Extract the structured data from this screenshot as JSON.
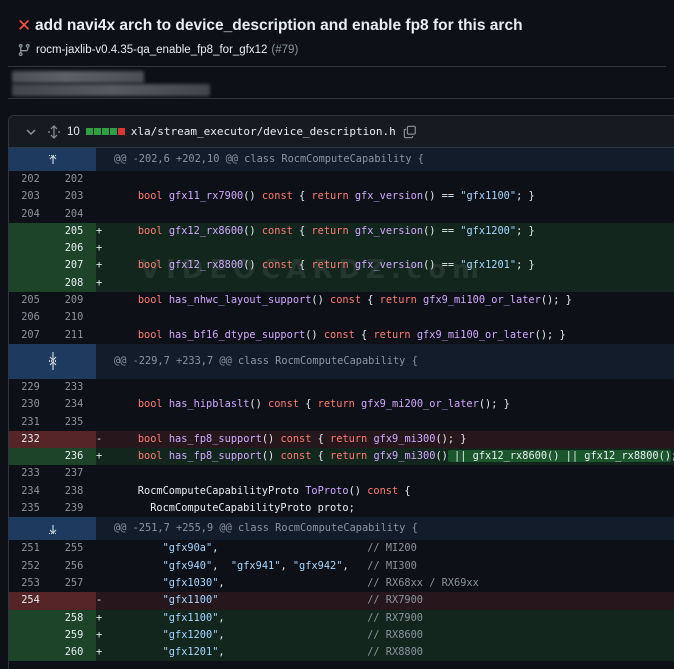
{
  "header": {
    "title": "add navi4x arch to device_description and enable fp8 for this arch",
    "branch": "rocm-jaxlib-v0.4.35-qa_enable_fp8_for_gfx12",
    "pr_number": "(#79)"
  },
  "file": {
    "changes": "10",
    "path": "xla/stream_executor/device_description.h",
    "diffstat": [
      "#2ea043",
      "#2ea043",
      "#2ea043",
      "#2ea043",
      "#da3633"
    ]
  },
  "rows": [
    {
      "type": "hunk",
      "text": "@@ -202,6 +202,10 @@ class RocmComputeCapability {",
      "icons": [
        "up"
      ]
    },
    {
      "type": "ctx",
      "o": "202",
      "n": "202",
      "segs": []
    },
    {
      "type": "ctx",
      "o": "203",
      "n": "203",
      "segs": [
        [
          "",
          "    "
        ],
        [
          "kw",
          "bool"
        ],
        [
          "",
          " "
        ],
        [
          "fn",
          "gfx11_rx7900"
        ],
        [
          "",
          "() "
        ],
        [
          "kw",
          "const"
        ],
        [
          "",
          " { "
        ],
        [
          "kw",
          "return"
        ],
        [
          "",
          " "
        ],
        [
          "fn",
          "gfx_version"
        ],
        [
          "",
          "() == "
        ],
        [
          "st",
          "\"gfx1100\""
        ],
        [
          "",
          "; }"
        ]
      ]
    },
    {
      "type": "ctx",
      "o": "204",
      "n": "204",
      "segs": []
    },
    {
      "type": "add",
      "o": "",
      "n": "205",
      "segs": [
        [
          "",
          "    "
        ],
        [
          "kw",
          "bool"
        ],
        [
          "",
          " "
        ],
        [
          "fn",
          "gfx12_rx8600"
        ],
        [
          "",
          "() "
        ],
        [
          "kw",
          "const"
        ],
        [
          "",
          " { "
        ],
        [
          "kw",
          "return"
        ],
        [
          "",
          " "
        ],
        [
          "fn",
          "gfx_version"
        ],
        [
          "",
          "() == "
        ],
        [
          "st",
          "\"gfx1200\""
        ],
        [
          "",
          "; }"
        ]
      ]
    },
    {
      "type": "add",
      "o": "",
      "n": "206",
      "segs": []
    },
    {
      "type": "add",
      "o": "",
      "n": "207",
      "segs": [
        [
          "",
          "    "
        ],
        [
          "kw",
          "bool"
        ],
        [
          "",
          " "
        ],
        [
          "fn",
          "gfx12_rx8800"
        ],
        [
          "",
          "() "
        ],
        [
          "kw",
          "const"
        ],
        [
          "",
          " { "
        ],
        [
          "kw",
          "return"
        ],
        [
          "",
          " "
        ],
        [
          "fn",
          "gfx_version"
        ],
        [
          "",
          "() == "
        ],
        [
          "st",
          "\"gfx1201\""
        ],
        [
          "",
          "; }"
        ]
      ]
    },
    {
      "type": "add",
      "o": "",
      "n": "208",
      "segs": []
    },
    {
      "type": "ctx",
      "o": "205",
      "n": "209",
      "segs": [
        [
          "",
          "    "
        ],
        [
          "kw",
          "bool"
        ],
        [
          "",
          " "
        ],
        [
          "fn",
          "has_nhwc_layout_support"
        ],
        [
          "",
          "() "
        ],
        [
          "kw",
          "const"
        ],
        [
          "",
          " { "
        ],
        [
          "kw",
          "return"
        ],
        [
          "",
          " "
        ],
        [
          "fn",
          "gfx9_mi100_or_later"
        ],
        [
          "",
          "(); }"
        ]
      ]
    },
    {
      "type": "ctx",
      "o": "206",
      "n": "210",
      "segs": []
    },
    {
      "type": "ctx",
      "o": "207",
      "n": "211",
      "segs": [
        [
          "",
          "    "
        ],
        [
          "kw",
          "bool"
        ],
        [
          "",
          " "
        ],
        [
          "fn",
          "has_bf16_dtype_support"
        ],
        [
          "",
          "() "
        ],
        [
          "kw",
          "const"
        ],
        [
          "",
          " { "
        ],
        [
          "kw",
          "return"
        ],
        [
          "",
          " "
        ],
        [
          "fn",
          "gfx9_mi100_or_later"
        ],
        [
          "",
          "(); }"
        ]
      ]
    },
    {
      "type": "hunk",
      "text": "@@ -229,7 +233,7 @@ class RocmComputeCapability {",
      "icons": [
        "down",
        "up"
      ]
    },
    {
      "type": "ctx",
      "o": "229",
      "n": "233",
      "segs": []
    },
    {
      "type": "ctx",
      "o": "230",
      "n": "234",
      "segs": [
        [
          "",
          "    "
        ],
        [
          "kw",
          "bool"
        ],
        [
          "",
          " "
        ],
        [
          "fn",
          "has_hipblaslt"
        ],
        [
          "",
          "() "
        ],
        [
          "kw",
          "const"
        ],
        [
          "",
          " { "
        ],
        [
          "kw",
          "return"
        ],
        [
          "",
          " "
        ],
        [
          "fn",
          "gfx9_mi200_or_later"
        ],
        [
          "",
          "(); }"
        ]
      ]
    },
    {
      "type": "ctx",
      "o": "231",
      "n": "235",
      "segs": []
    },
    {
      "type": "del",
      "o": "232",
      "n": "",
      "segs": [
        [
          "",
          "    "
        ],
        [
          "kw",
          "bool"
        ],
        [
          "",
          " "
        ],
        [
          "fn",
          "has_fp8_support"
        ],
        [
          "",
          "() "
        ],
        [
          "kw",
          "const"
        ],
        [
          "",
          " { "
        ],
        [
          "kw",
          "return"
        ],
        [
          "",
          " "
        ],
        [
          "fn",
          "gfx9_mi300"
        ],
        [
          "",
          "(); }"
        ]
      ]
    },
    {
      "type": "add",
      "o": "",
      "n": "236",
      "segs": [
        [
          "",
          "    "
        ],
        [
          "kw",
          "bool"
        ],
        [
          "",
          " "
        ],
        [
          "fn",
          "has_fp8_support"
        ],
        [
          "",
          "() "
        ],
        [
          "kw",
          "const"
        ],
        [
          "",
          " { "
        ],
        [
          "kw",
          "return"
        ],
        [
          "",
          " "
        ],
        [
          "fn",
          "gfx9_mi300"
        ],
        [
          "",
          "()"
        ],
        [
          "hl",
          " || gfx12_rx8600() || gfx12_rx8800()"
        ],
        [
          "",
          "; }"
        ]
      ]
    },
    {
      "type": "ctx",
      "o": "233",
      "n": "237",
      "segs": []
    },
    {
      "type": "ctx",
      "o": "234",
      "n": "238",
      "segs": [
        [
          "",
          "    RocmComputeCapabilityProto "
        ],
        [
          "fn",
          "ToProto"
        ],
        [
          "",
          "() "
        ],
        [
          "kw",
          "const"
        ],
        [
          "",
          " {"
        ]
      ]
    },
    {
      "type": "ctx",
      "o": "235",
      "n": "239",
      "segs": [
        [
          "",
          "      RocmComputeCapabilityProto proto;"
        ]
      ]
    },
    {
      "type": "hunk",
      "text": "@@ -251,7 +255,9 @@ class RocmComputeCapability {",
      "icons": [
        "down"
      ]
    },
    {
      "type": "ctx",
      "o": "251",
      "n": "255",
      "segs": [
        [
          "",
          "        "
        ],
        [
          "st",
          "\"gfx90a\""
        ],
        [
          "",
          ",                        "
        ],
        [
          "cm",
          "// MI200"
        ]
      ]
    },
    {
      "type": "ctx",
      "o": "252",
      "n": "256",
      "segs": [
        [
          "",
          "        "
        ],
        [
          "st",
          "\"gfx940\""
        ],
        [
          "",
          ",  "
        ],
        [
          "st",
          "\"gfx941\""
        ],
        [
          "",
          ", "
        ],
        [
          "st",
          "\"gfx942\""
        ],
        [
          "",
          ",   "
        ],
        [
          "cm",
          "// MI300"
        ]
      ]
    },
    {
      "type": "ctx",
      "o": "253",
      "n": "257",
      "segs": [
        [
          "",
          "        "
        ],
        [
          "st",
          "\"gfx1030\""
        ],
        [
          "",
          ",                       "
        ],
        [
          "cm",
          "// RX68xx / RX69xx"
        ]
      ]
    },
    {
      "type": "del",
      "o": "254",
      "n": "",
      "segs": [
        [
          "",
          "        "
        ],
        [
          "st",
          "\"gfx1100\""
        ],
        [
          "",
          "                        "
        ],
        [
          "cm",
          "// RX7900"
        ]
      ]
    },
    {
      "type": "add",
      "o": "",
      "n": "258",
      "segs": [
        [
          "",
          "        "
        ],
        [
          "st",
          "\"gfx1100\""
        ],
        [
          "",
          ",                       "
        ],
        [
          "cm",
          "// RX7900"
        ]
      ]
    },
    {
      "type": "add",
      "o": "",
      "n": "259",
      "segs": [
        [
          "",
          "        "
        ],
        [
          "st",
          "\"gfx1200\""
        ],
        [
          "",
          ",                       "
        ],
        [
          "cm",
          "// RX8600"
        ]
      ]
    },
    {
      "type": "add",
      "o": "",
      "n": "260",
      "segs": [
        [
          "",
          "        "
        ],
        [
          "st",
          "\"gfx1201\""
        ],
        [
          "",
          ",                       "
        ],
        [
          "cm",
          "// RX8800"
        ]
      ]
    }
  ],
  "watermark": "VIDEOCARDZ.com"
}
